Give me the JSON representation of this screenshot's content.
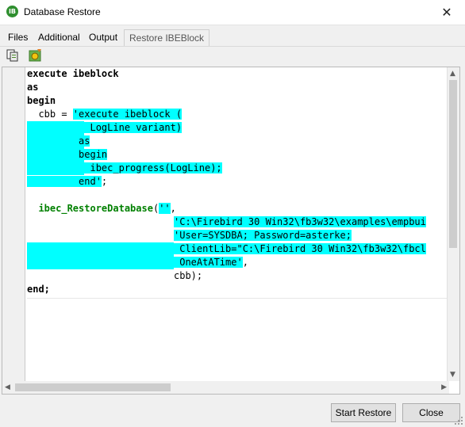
{
  "window": {
    "title": "Database Restore",
    "icon_text": "IB"
  },
  "tabs": [
    {
      "label": "Files"
    },
    {
      "label": "Additional"
    },
    {
      "label": "Output"
    },
    {
      "label": "Restore IBEBlock"
    }
  ],
  "toolbar": {
    "copy_icon": "copy-icon",
    "run_icon": "run-icon"
  },
  "code": {
    "l1": "execute ibeblock",
    "l2": "as",
    "l3": "begin",
    "l4_pre": "  cbb = ",
    "l4_hl": "'execute ibeblock (",
    "l5_hl": "           LogLine variant)",
    "l6_hl": "         as",
    "l7_hl": "         begin",
    "l8_hl": "           ibec_progress(LogLine);",
    "l9_hl": "         end'",
    "l9_post": ";",
    "l11_fn": "  ibec_RestoreDatabase",
    "l11_pre": "(",
    "l11_hl": "''",
    "l11_post": ",",
    "l12_hl": "'C:\\Firebird 30 Win32\\fb3w32\\examples\\empbui",
    "l13_hl": "'User=SYSDBA; Password=asterke;",
    "l14_hl": " ClientLib=\"C:\\Firebird 30 Win32\\fb3w32\\fbcl",
    "l15_hl": " OneAtATime'",
    "l15_post": ",",
    "l16": "cbb);",
    "l17": "end;"
  },
  "buttons": {
    "start_restore": "Start Restore",
    "close": "Close"
  },
  "colors": {
    "selection": "#00ffff",
    "function": "#008000"
  }
}
